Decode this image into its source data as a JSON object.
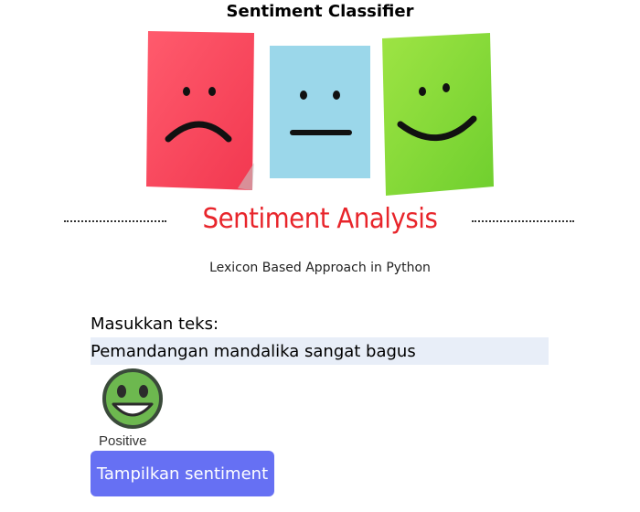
{
  "app": {
    "title": "Sentiment Classifier"
  },
  "banner": {
    "title": "Sentiment Analysis",
    "subtitle": "Lexicon Based Approach in Python",
    "colors": {
      "sad": "#f5475f",
      "neutral": "#9bd7ea",
      "happy": "#86d83c",
      "title": "#e8252b"
    }
  },
  "form": {
    "label": "Masukkan teks:",
    "input_value": "Pemandangan mandalika sangat bagus",
    "button_label": "Tampilkan sentiment"
  },
  "result": {
    "label": "Positive",
    "icon": "happy-face-icon"
  },
  "colors": {
    "button": "#6670f3",
    "input_bg": "#e8eef8"
  }
}
